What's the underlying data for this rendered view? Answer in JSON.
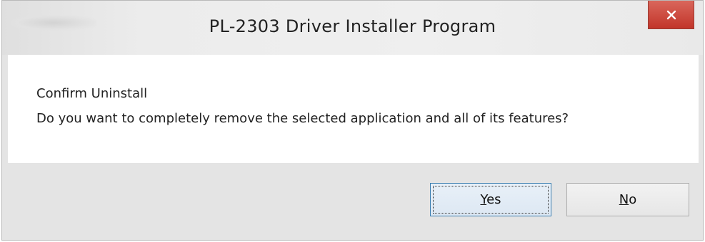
{
  "window": {
    "title": "PL-2303 Driver Installer Program",
    "close_icon": "close-x-icon",
    "accent_close": "#c94f44"
  },
  "dialog": {
    "heading": "Confirm Uninstall",
    "message": "Do you want to completely remove the selected application and all of its features?"
  },
  "buttons": {
    "yes": {
      "accel": "Y",
      "rest": "es"
    },
    "no": {
      "accel": "N",
      "rest": "o"
    }
  }
}
